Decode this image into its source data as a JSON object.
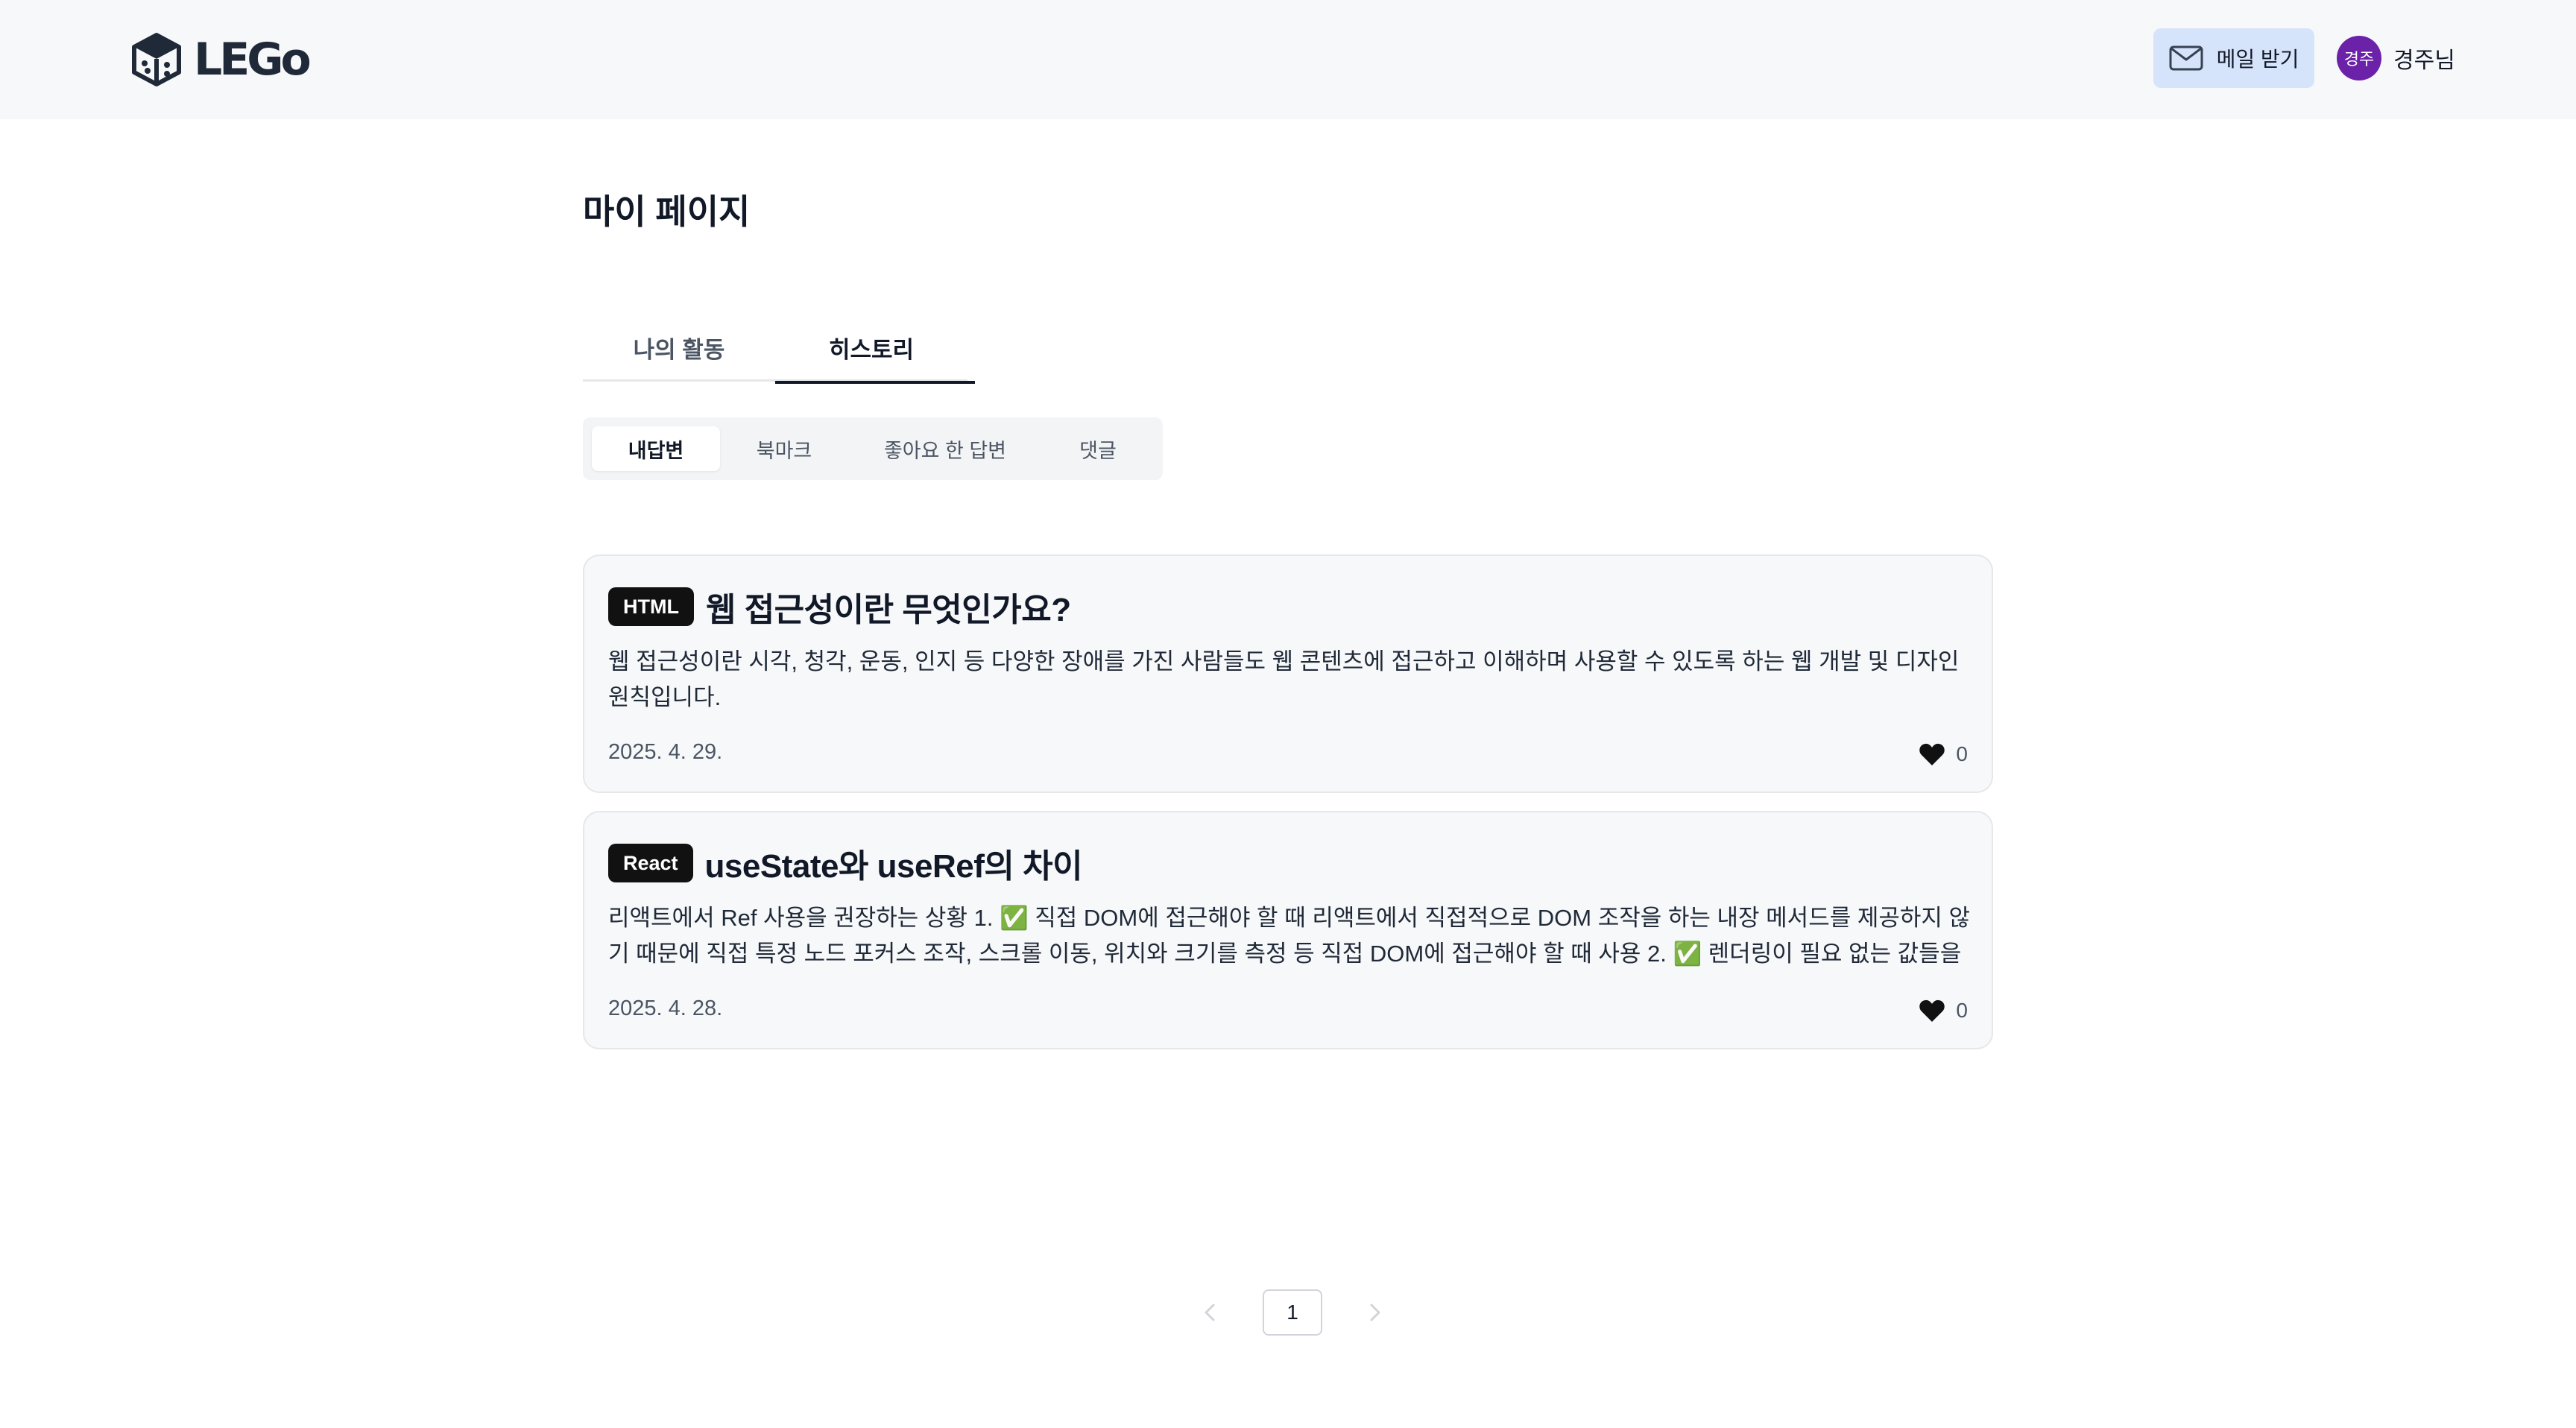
{
  "header": {
    "logo_text": "LEGo",
    "mail_button_label": "메일 받기",
    "avatar_text": "경주",
    "user_name": "경주님"
  },
  "page": {
    "title": "마이 페이지"
  },
  "main_tabs": [
    {
      "label": "나의 활동",
      "active": false
    },
    {
      "label": "히스토리",
      "active": true
    }
  ],
  "sub_tabs": [
    {
      "label": "내답변",
      "active": true
    },
    {
      "label": "북마크",
      "active": false
    },
    {
      "label": "좋아요 한 답변",
      "active": false
    },
    {
      "label": "댓글",
      "active": false
    }
  ],
  "cards": [
    {
      "tag": "HTML",
      "title": "웹 접근성이란 무엇인가요?",
      "body": "웹 접근성이란 시각, 청각, 운동, 인지 등 다양한 장애를 가진 사람들도 웹 콘텐츠에 접근하고 이해하며 사용할 수 있도록 하는 웹 개발 및 디자인 원칙입니다.",
      "date": "2025. 4. 29.",
      "likes": "0"
    },
    {
      "tag": "React",
      "title": "useState와 useRef의 차이",
      "body": "리액트에서 Ref 사용을 권장하는 상황 1. ✅ 직접 DOM에 접근해야 할 때 리액트에서 직접적으로 DOM 조작을 하는 내장 메서드를 제공하지 않기 때문에 직접 특정 노드 포커스 조작, 스크롤 이동, 위치와 크기를 측정 등 직접 DOM에 접근해야 할 때 사용 2. ✅ 렌더링이 필요 없는 값들을 저장...",
      "date": "2025. 4. 28.",
      "likes": "0"
    }
  ],
  "pagination": {
    "current_page": "1"
  },
  "colors": {
    "header_bg": "#f7f8fa",
    "mail_button_bg": "#d6e4fb",
    "avatar_bg": "#6b21a8",
    "tag_bg": "#111111",
    "card_bg": "#f7f8fa"
  },
  "icons": {
    "logo": "cube-logo-icon",
    "mail": "mail-icon",
    "like": "heart-icon",
    "prev": "chevron-left-icon",
    "next": "chevron-right-icon"
  }
}
